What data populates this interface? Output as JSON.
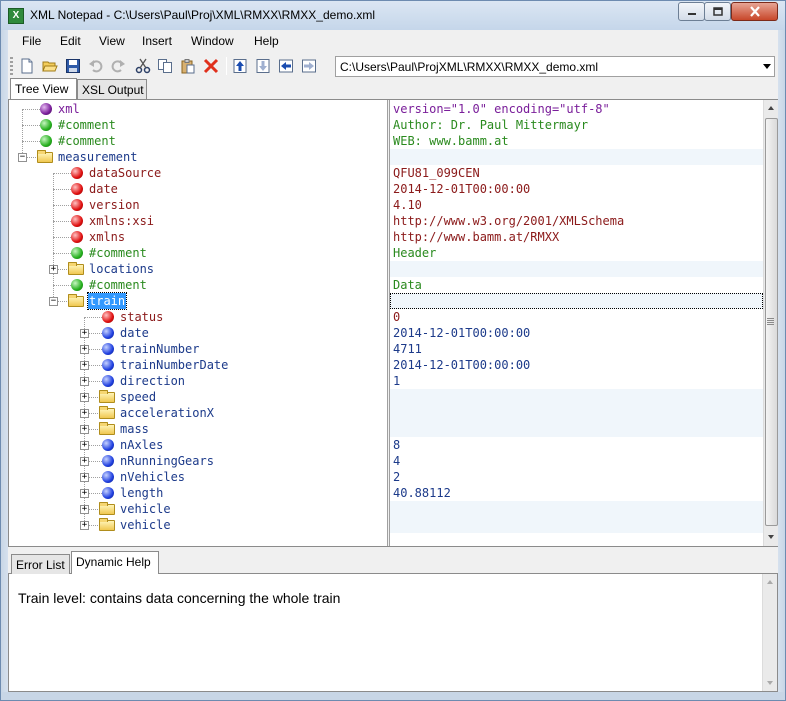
{
  "window": {
    "title": "XML Notepad - C:\\Users\\Paul\\Proj\\XML\\RMXX\\RMXX_demo.xml",
    "app_icon_letter": "X"
  },
  "menu": {
    "items": [
      "File",
      "Edit",
      "View",
      "Insert",
      "Window",
      "Help"
    ]
  },
  "toolbar": {
    "icons": [
      "new-file-icon",
      "open-folder-icon",
      "save-icon",
      "undo-icon",
      "redo-icon",
      "cut-icon",
      "copy-icon",
      "paste-icon",
      "delete-icon",
      "nudge-up-icon",
      "nudge-down-icon",
      "nudge-left-icon",
      "nudge-right-icon"
    ],
    "path": "C:\\Users\\Paul\\ProjXML\\RMXX\\RMXX_demo.xml"
  },
  "top_tabs": {
    "tree_view": "Tree View",
    "xsl_output": "XSL Output"
  },
  "tree": [
    {
      "label": "xml",
      "icon": "purple",
      "value": "version=\"1.0\" encoding=\"utf-8\""
    },
    {
      "label": "#comment",
      "icon": "green",
      "value": "Author: Dr. Paul Mittermayr"
    },
    {
      "label": "#comment",
      "icon": "green",
      "value": "WEB:    www.bamm.at"
    },
    {
      "label": "measurement",
      "icon": "folder",
      "value": ""
    },
    {
      "label": "dataSource",
      "icon": "red",
      "value": "QFU81_099CEN"
    },
    {
      "label": "date",
      "icon": "red",
      "value": "2014-12-01T00:00:00"
    },
    {
      "label": "version",
      "icon": "red",
      "value": "4.10"
    },
    {
      "label": "xmlns:xsi",
      "icon": "red",
      "value": "http://www.w3.org/2001/XMLSchema"
    },
    {
      "label": "xmlns",
      "icon": "red",
      "value": "http://www.bamm.at/RMXX"
    },
    {
      "label": "#comment",
      "icon": "green",
      "value": "Header"
    },
    {
      "label": "locations",
      "icon": "folder",
      "value": ""
    },
    {
      "label": "#comment",
      "icon": "green",
      "value": "Data"
    },
    {
      "label": "train",
      "icon": "folder",
      "value": ""
    },
    {
      "label": "status",
      "icon": "red",
      "value": "0"
    },
    {
      "label": "date",
      "icon": "blue",
      "value": "2014-12-01T00:00:00"
    },
    {
      "label": "trainNumber",
      "icon": "blue",
      "value": "4711"
    },
    {
      "label": "trainNumberDate",
      "icon": "blue",
      "value": "2014-12-01T00:00:00"
    },
    {
      "label": "direction",
      "icon": "blue",
      "value": "1"
    },
    {
      "label": "speed",
      "icon": "folder",
      "value": ""
    },
    {
      "label": "accelerationX",
      "icon": "folder",
      "value": ""
    },
    {
      "label": "mass",
      "icon": "folder",
      "value": ""
    },
    {
      "label": "nAxles",
      "icon": "blue",
      "value": "8"
    },
    {
      "label": "nRunningGears",
      "icon": "blue",
      "value": "4"
    },
    {
      "label": "nVehicles",
      "icon": "blue",
      "value": "2"
    },
    {
      "label": "length",
      "icon": "blue",
      "value": "40.88112"
    },
    {
      "label": "vehicle",
      "icon": "folder",
      "value": ""
    },
    {
      "label": "vehicle",
      "icon": "folder",
      "value": ""
    }
  ],
  "bottom_tabs": {
    "error_list": "Error List",
    "dynamic_help": "Dynamic Help"
  },
  "help_text": "Train level: contains data concerning the whole train",
  "colors": {
    "selection": "#3399ff",
    "comment": "#2a8a1e",
    "attribute": "#8b1a1a",
    "element": "#1c3a8a",
    "pi": "#7a1e9a"
  }
}
